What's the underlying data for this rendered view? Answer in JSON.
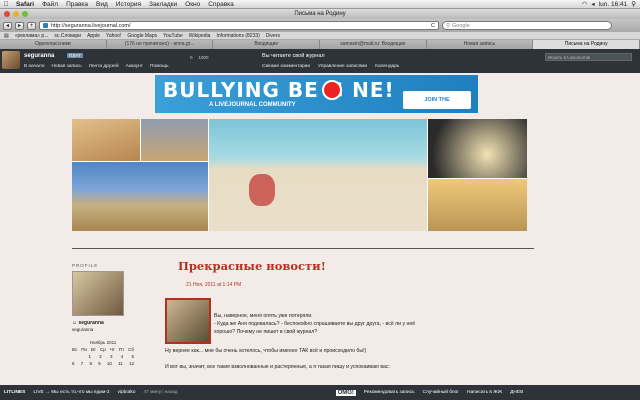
{
  "menubar": {
    "apple": "",
    "items": [
      "Safari",
      "Файл",
      "Правка",
      "Вид",
      "История",
      "Закладки",
      "Окно",
      "Справка"
    ],
    "clock": "lun. 16:41"
  },
  "window": {
    "title": "Письма на Родину"
  },
  "toolbar": {
    "back": "◂",
    "forward": "▸",
    "add": "+",
    "url": "http://seguranna.livejournal.com/",
    "reload": "C",
    "search_placeholder": "Google"
  },
  "bookmarks": [
    "«реклама» р...",
    "sc.Словари",
    "Apple",
    "Yahoo!",
    "Google Maps",
    "YouTube",
    "Wikipedia",
    "Informations (8233)",
    "Divers"
  ],
  "tabs": [
    {
      "label": "Одноклассники",
      "active": false
    },
    {
      "label": "(176 не прочитано) - anna.gr...",
      "active": false
    },
    {
      "label": "Входящие",
      "active": false
    },
    {
      "label": "samasin@mail.ru: Входящие",
      "active": false
    },
    {
      "label": "Новая запись",
      "active": false
    },
    {
      "label": "Письма на Родину",
      "active": true
    }
  ],
  "ljbar": {
    "username": "seguranna",
    "badge": "ПЛАТ",
    "nav": [
      "В начало",
      "Новая запись",
      "Лента друзей",
      "Аккаунт",
      "Помощь"
    ],
    "counts": [
      "0",
      "1000"
    ],
    "reading": "Вы читаете свой журнал",
    "nav2": [
      "Свежие комментарии",
      "Управление записями",
      "Календарь"
    ],
    "search_placeholder": "Искать в LiveJournal"
  },
  "banner": {
    "headline": "BULLYING BE G  NE!",
    "sub": "A LIVEJOURNAL COMMUNITY",
    "cta": "JOIN THE CONVERSATION"
  },
  "sidebar": {
    "profile_label": "PROFILE",
    "username": "seguranna",
    "username2": "seguranna",
    "calendar_title": "Ноябрь 2011",
    "weekdays": [
      "Вс",
      "Пн",
      "Вт",
      "Ср",
      "Чт",
      "Пт",
      "Сб"
    ],
    "row1": [
      "",
      "",
      "1",
      "2",
      "3",
      "4",
      "5"
    ],
    "row2": [
      "6",
      "7",
      "8",
      "9",
      "10",
      "11",
      "12"
    ]
  },
  "post": {
    "title": "Прекрасные новости!",
    "date": "21 Ноя, 2011 at 1:14 PM",
    "line1": "Вы, наверное, меня опять уже потеряли.",
    "line2": "- Куда же Аня подевалась? - беспокойно спрашиваете вы друг друга, - всё ли у неё",
    "line3": "хорошо? Почему не пишет в свой журнал?",
    "line4": "Ну вернее как... мне бы очень хотелось, чтобы именно ТАК всё и происходило бы!)",
    "line5": "И вот вы, значит, все такие взволнованные и растерянные, а я такая пишу и успокаиваю вас:"
  },
  "statusbar": {
    "brand": "LITLINES",
    "item1": "LIVE → Мы есть то,что мы едим-2",
    "item2": "vipbotko",
    "item3": "47 минут назад",
    "omg": "OMG!",
    "links": [
      "Рекомендовать запись",
      "Случайный блог",
      "Написать в ЖЖ",
      "ДНЕВ"
    ]
  },
  "colors": {
    "ljbar": "#2d3338",
    "title_red": "#b1331f",
    "banner_blue": "#1f7fc0"
  }
}
